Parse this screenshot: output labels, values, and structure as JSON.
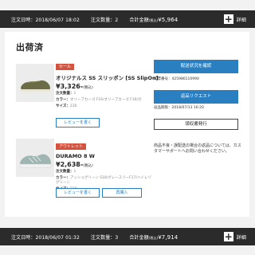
{
  "order1": {
    "date": "注文日時：2018/06/07 18:02",
    "qty": "注文数量：2",
    "total_label": "合計金額",
    "total_tax": "(税込)",
    "total": "¥5,964",
    "detail": "詳細"
  },
  "card": {
    "status": "出荷済",
    "ship_button": "配送状況を確認",
    "tracking": "伝票番号：425986110990",
    "return_button": "返品リクエスト",
    "deadline": "返品期限：2018/07/13 16:20",
    "receipt_button": "領収書発行",
    "note": "商品不良・誤配送の場合の返品については、カスタマーサポートへお問い合わせください。"
  },
  "items": [
    {
      "badge": "セール",
      "name": "オリジナルス SS スリッポン [SS SlipOn]",
      "price": "¥3,326-",
      "tax": "(税込)",
      "qty_label": "注文数量：",
      "qty": "1",
      "color_label": "カラー：",
      "color": "オリーブカーゴ F16/オリーブカーゴ F16/ガ",
      "size_label": "サイズ：",
      "size": "230",
      "review": "レビューを書く"
    },
    {
      "badge": "アウトレット",
      "name": "DURAMO 8 W",
      "price": "¥2,638-",
      "tax": "(税込)",
      "qty_label": "注文数量：",
      "qty": "1",
      "color_label": "カラー：",
      "color": "アッシュグリーン S18/グレースリーF17/ハイレゾグリーン",
      "size_label": "サイズ：",
      "size": "230",
      "review": "レビューを書く",
      "rebuy": "再購入"
    }
  ],
  "order2": {
    "date": "注文日時：2018/06/07 01:32",
    "qty": "注文数量：3",
    "total_label": "合計金額",
    "total_tax": "(税込)",
    "total": "¥7,914",
    "detail": "詳細"
  },
  "colors": {
    "bar": "#2b2b2b",
    "accent": "#2a7fc1",
    "badge": "#d4533f"
  },
  "icons": {
    "expand": "plus-icon"
  }
}
